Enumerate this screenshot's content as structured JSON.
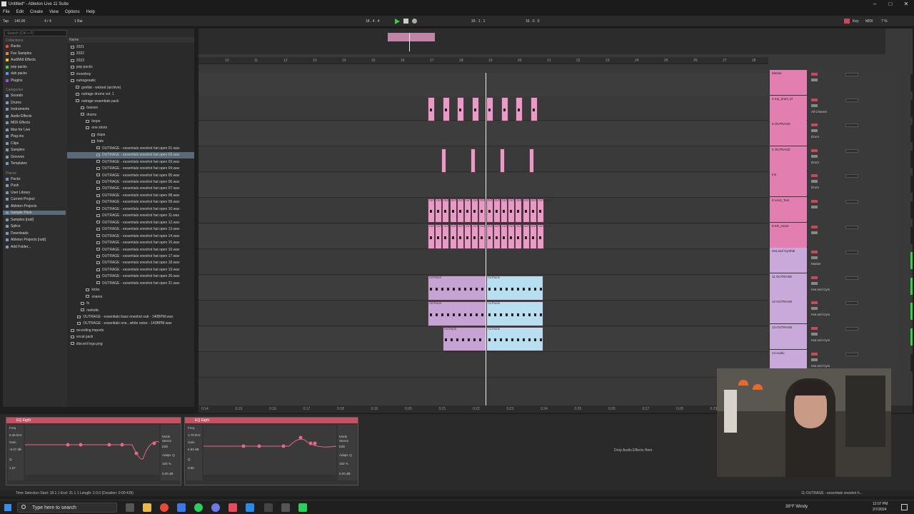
{
  "window": {
    "title": "Untitled* - Ableton Live 11 Suite",
    "min": "–",
    "max": "□",
    "close": "✕"
  },
  "menu": [
    "File",
    "Edit",
    "Create",
    "View",
    "Options",
    "Help"
  ],
  "transport": {
    "tap": "Tap",
    "tempo": "140.00",
    "sig": "4 / 4",
    "quant": "1 Bar",
    "position": "18 . 4 . 4",
    "loop_start": "33 . 1 . 1",
    "loop_len": "16 . 0 . 0",
    "key": "Key",
    "midi": "MIDI",
    "cpu": "7 %"
  },
  "browser": {
    "search_placeholder": "Search (Ctrl + F)",
    "collections_header": "Collections",
    "collections": [
      {
        "label": "Racks",
        "color": "#e84a4a"
      },
      {
        "label": "Fav Samples",
        "color": "#e88a2a"
      },
      {
        "label": "Aud/Mid Effects",
        "color": "#e8c42a"
      },
      {
        "label": "pop packs",
        "color": "#4ac84a"
      },
      {
        "label": "dub packs",
        "color": "#4a9ae8"
      },
      {
        "label": "Plugins",
        "color": "#a04ae8"
      }
    ],
    "categories_header": "Categories",
    "categories": [
      "Sounds",
      "Drums",
      "Instruments",
      "Audio Effects",
      "MIDI Effects",
      "Max for Live",
      "Plug-ins",
      "Clips",
      "Samples",
      "Grooves",
      "Templates"
    ],
    "places_header": "Places",
    "places": [
      "Packs",
      "Push",
      "User Library",
      "Current Project",
      "Ableton Projects",
      "Sample Pack",
      "Samples [raid]",
      "Splice",
      "Downloads",
      "Ableton Projects [raid]",
      "Add Folder..."
    ],
    "name_header": "Name",
    "files": [
      "2021",
      "2022",
      "2023",
      "pop packs",
      "moonboy",
      "outragesatic",
      "gorillat - wicked (archive)",
      "outrage drums vol. 1",
      "outrage essentials pack",
      "basses",
      "drums",
      "loops",
      "one shots",
      "claps",
      "hats",
      "OUTRAGE - essentials oneshot hat open 01.wav",
      "OUTRAGE - essentials oneshot hat open 02.wav",
      "OUTRAGE - essentials oneshot hat open 03.wav",
      "OUTRAGE - essentials oneshot hat open 04.wav",
      "OUTRAGE - essentials oneshot hat open 05.wav",
      "OUTRAGE - essentials oneshot hat open 06.wav",
      "OUTRAGE - essentials oneshot hat open 07.wav",
      "OUTRAGE - essentials oneshot hat open 08.wav",
      "OUTRAGE - essentials oneshot hat open 09.wav",
      "OUTRAGE - essentials oneshot hat open 10.wav",
      "OUTRAGE - essentials oneshot hat open 11.wav",
      "OUTRAGE - essentials oneshot hat open 12.wav",
      "OUTRAGE - essentials oneshot hat open 13.wav",
      "OUTRAGE - essentials oneshot hat open 14.wav",
      "OUTRAGE - essentials oneshot hat open 15.wav",
      "OUTRAGE - essentials oneshot hat open 16.wav",
      "OUTRAGE - essentials oneshot hat open 17.wav",
      "OUTRAGE - essentials oneshot hat open 18.wav",
      "OUTRAGE - essentials oneshot hat open 19.wav",
      "OUTRAGE - essentials oneshot hat open 20.wav",
      "OUTRAGE - essentials oneshot hat open 21.wav",
      "kicks",
      "snares",
      "fx",
      "melodic",
      "OUTRAGE - essentials bass oneshot sub - 140BPM.wav",
      "OUTRAGE - essentials one...white noise - 140BPM.wav",
      "recording imports",
      "vocal pack",
      "discord logo.png"
    ]
  },
  "ruler": [
    "10",
    "11",
    "12",
    "13",
    "14",
    "15",
    "16",
    "17",
    "18",
    "19",
    "20",
    "21",
    "22",
    "23",
    "24",
    "25",
    "26",
    "27",
    "28"
  ],
  "time_ticks": [
    "0:14",
    "0:15",
    "0:16",
    "0:17",
    "0:18",
    "0:19",
    "0:20",
    "0:21",
    "0:22",
    "0:23",
    "0:24",
    "0:25",
    "0:26",
    "0:27",
    "0:28",
    "0:29",
    "0:30"
  ],
  "clip_label": "OUTRAGE",
  "tracks": [
    {
      "name": "Master",
      "route": "",
      "vol": "0.00"
    },
    {
      "name": "4 KQ_drum_kl",
      "route": "All Channe",
      "vol": "0.00"
    },
    {
      "name": "5 OUTRAGE",
      "route": "Drum",
      "vol": "0.00"
    },
    {
      "name": "6 OUTRAGE",
      "route": "Drum",
      "vol": "0.00"
    },
    {
      "name": "Inn",
      "route": "Drum",
      "vol": "0.00"
    },
    {
      "name": "8 Lev2_Tom",
      "route": "",
      "vol": "0.00"
    },
    {
      "name": "9 KR_snare",
      "route": "",
      "vol": "0.00"
    },
    {
      "name": "Hat and Cymbal",
      "route": "Master",
      "vol": "0.00"
    },
    {
      "name": "11 OUTRAGE",
      "route": "Hat and Cym",
      "vol": "0.00"
    },
    {
      "name": "12 OUTRAGE",
      "route": "Hat and Cym",
      "vol": "0.00"
    },
    {
      "name": "13 OUTRAGE",
      "route": "Hat and Cym",
      "vol": "0.00"
    },
    {
      "name": "14 Audio",
      "route": "Hat and Cym",
      "vol": "0.00"
    }
  ],
  "devices": {
    "eq1": "EQ Eight",
    "eq2": "EQ Eight",
    "drop": "Drop Audio Effects Here",
    "eq_params": [
      "Freq",
      "Gain",
      "Q",
      "Mode",
      "Stereo",
      "Edit",
      "Adapt. Q",
      "Scale",
      "Gain"
    ],
    "eq1_vals": [
      "6.35 kHz",
      "-6.07 dB",
      "1.67",
      "100 %",
      "0.00 dB"
    ],
    "eq2_vals": [
      "1.78 kHz",
      "6.83 dB",
      "0.85",
      "100 %",
      "0.00 dB"
    ]
  },
  "status": {
    "left": "Time Selection   Start: 18.1.1   End: 31.1.1   Length: 2.0.0  (Duration: 0:00:439)",
    "right": "11-OUTRAGE - essentials oneshot h..."
  },
  "taskbar": {
    "search": "Type here to search",
    "weather": "39°F  Windy",
    "time": "12:07 PM",
    "date": "2/7/2024"
  }
}
